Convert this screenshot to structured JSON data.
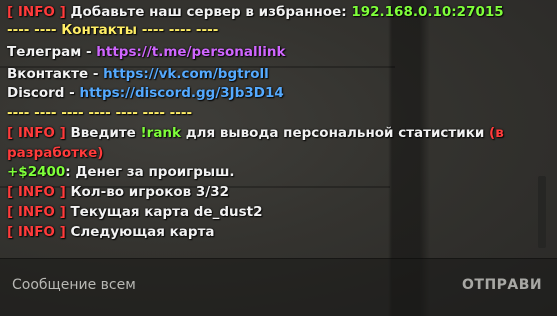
{
  "chat": {
    "lines": [
      {
        "tag": "[ INFO ]",
        "text": "Добавьте наш сервер в избранное:",
        "value": "192.168.0.10:27015"
      },
      {
        "text": "---- ---- Контакты ---- ---- ----"
      },
      {
        "label": "Телеграм - ",
        "link": "https://t.me/personallink"
      },
      {
        "label": "Вконтакте - ",
        "link": "https://vk.com/bgtroll"
      },
      {
        "label": "Discord - ",
        "link": "https://discord.gg/3Jb3D14"
      },
      {
        "text": "---- ---- ---- ---- ---- ---- ----"
      },
      {
        "tag": "[ INFO ]",
        "text_before": "Введите ",
        "highlight": "!rank",
        "text_after": " для вывода персональной статистики ",
        "wip_start": "(в"
      },
      {
        "wip_end": "разработке)"
      },
      {
        "amount": "+$2400",
        "text": ": Денег за проигрыш."
      },
      {
        "tag": "[ INFO ]",
        "text": "Кол-во игроков 3/32"
      },
      {
        "tag": "[ INFO ]",
        "text": "Текущая карта de_dust2"
      },
      {
        "tag": "[ INFO ]",
        "text": "Следующая карта"
      }
    ]
  },
  "input": {
    "placeholder": "Сообщение всем"
  },
  "send_button": {
    "label": "ОТПРАВИ"
  },
  "colors": {
    "tag": "#ff3b3b",
    "green": "#7fff3a",
    "yellow": "#ffee66",
    "violet": "#d066ff",
    "blue": "#55aaff"
  }
}
